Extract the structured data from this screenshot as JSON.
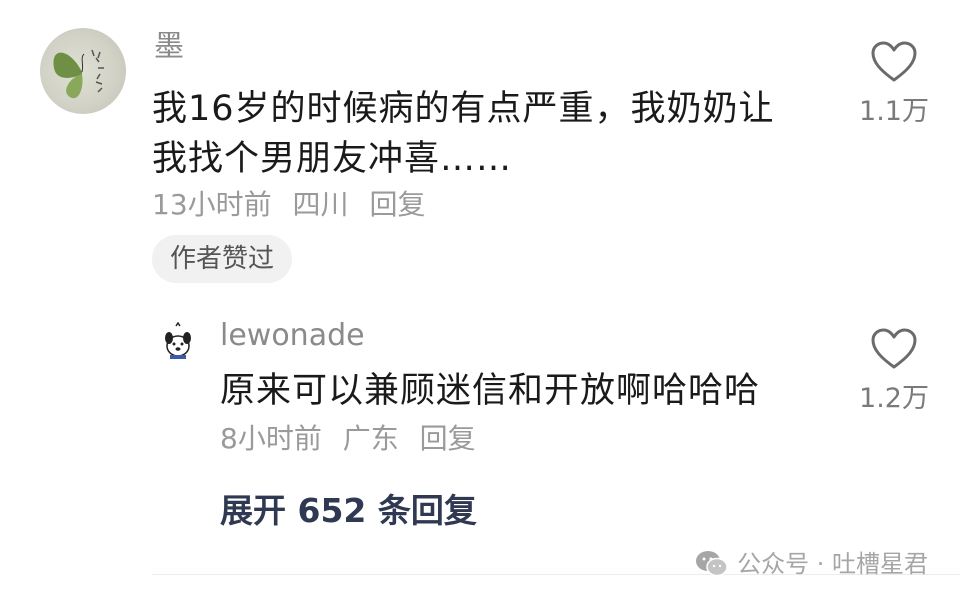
{
  "comment": {
    "username": "墨",
    "text_line1": "我16岁的时候病的有点严重，我奶奶让",
    "text_line2": "我找个男朋友冲喜……",
    "time": "13小时前",
    "location": "四川",
    "reply_label": "回复",
    "author_badge": "作者赞过",
    "like_count": "1.1万",
    "like_icon": "heart-outline-icon"
  },
  "reply": {
    "username": "lewonade",
    "text": "原来可以兼顾迷信和开放啊哈哈哈",
    "time": "8小时前",
    "location": "广东",
    "reply_label": "回复",
    "like_count": "1.2万",
    "like_icon": "heart-outline-icon"
  },
  "expand_replies": "展开 652 条回复",
  "watermark": {
    "text": "公众号 · 吐槽星君",
    "icon": "wechat-icon"
  },
  "colors": {
    "text_primary": "#1a1a1a",
    "text_secondary": "#9a9a9a",
    "expand_link": "#2f3a52"
  }
}
